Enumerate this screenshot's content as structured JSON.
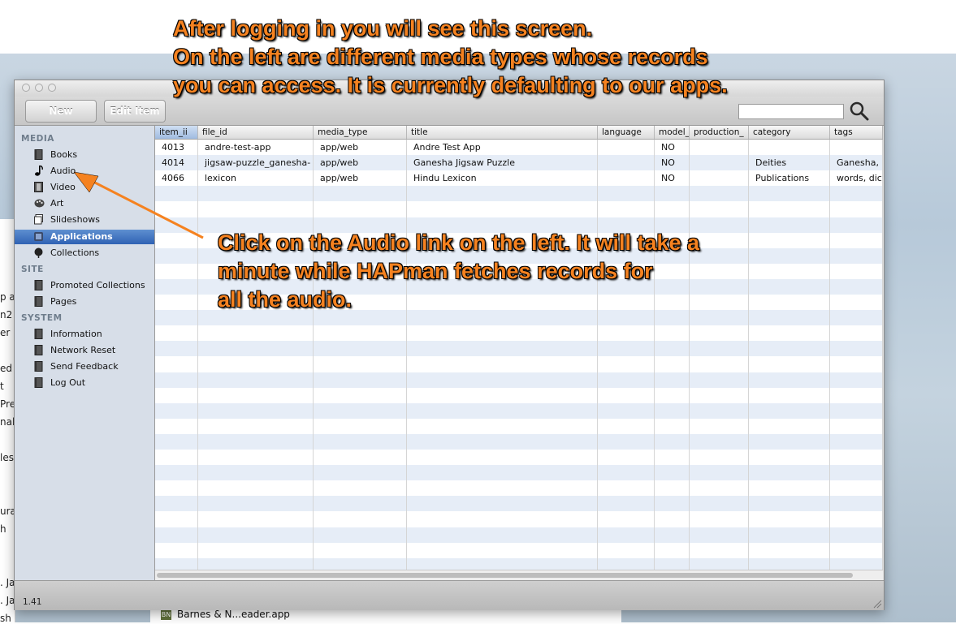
{
  "annotations": {
    "top": "After logging in you will see this screen.\nOn the left are different media types whose records\nyou can access. It is currently defaulting to our apps.",
    "middle": "Click on the Audio link on the left. It will take a\nminute while HAPman fetches records for\nall the audio."
  },
  "toolbar": {
    "new_label": "New",
    "edit_label": "Edit Item",
    "search_value": ""
  },
  "sidebar": {
    "sections": [
      {
        "heading": "MEDIA",
        "items": [
          {
            "label": "Books",
            "icon": "book-icon"
          },
          {
            "label": "Audio",
            "icon": "music-note-icon"
          },
          {
            "label": "Video",
            "icon": "film-icon"
          },
          {
            "label": "Art",
            "icon": "palette-icon"
          },
          {
            "label": "Slideshows",
            "icon": "slideshow-icon"
          },
          {
            "label": "Applications",
            "icon": "app-icon",
            "selected": true
          },
          {
            "label": "Collections",
            "icon": "collection-icon"
          }
        ]
      },
      {
        "heading": "SITE",
        "items": [
          {
            "label": "Promoted Collections",
            "icon": "book-icon"
          },
          {
            "label": "Pages",
            "icon": "book-icon"
          }
        ]
      },
      {
        "heading": "SYSTEM",
        "items": [
          {
            "label": "Information",
            "icon": "book-icon"
          },
          {
            "label": "Network Reset",
            "icon": "book-icon"
          },
          {
            "label": "Send Feedback",
            "icon": "book-icon"
          },
          {
            "label": "Log Out",
            "icon": "book-icon"
          }
        ]
      }
    ]
  },
  "table": {
    "columns": [
      "item_ii",
      "file_id",
      "media_type",
      "title",
      "language",
      "model_",
      "production_",
      "category",
      "tags"
    ],
    "sorted_column": "item_ii",
    "rows": [
      [
        "4013",
        "andre-test-app",
        "app/web",
        "Andre Test App",
        "",
        "NO",
        "",
        "",
        ""
      ],
      [
        "4014",
        "jigsaw-puzzle_ganesha-",
        "app/web",
        "Ganesha Jigsaw Puzzle",
        "",
        "NO",
        "",
        "Deities",
        "Ganesha, g"
      ],
      [
        "4066",
        "lexicon",
        "app/web",
        "Hindu Lexicon",
        "",
        "NO",
        "",
        "Publications",
        "words, dict"
      ]
    ]
  },
  "status": {
    "version": "1.41"
  },
  "background": {
    "fragments": [
      "p a",
      "n2",
      "er",
      "ed",
      "t",
      "Pre",
      "nal",
      "les",
      "ura",
      "h",
      ". Ja",
      ". Ja",
      "sh"
    ],
    "finder_item": "Barnes & N...eader.app",
    "finder_icon_text": "BN"
  },
  "colors": {
    "annotation": "#f58220",
    "selection": "#2f62b4",
    "row_stripe": "#e6edf7"
  }
}
